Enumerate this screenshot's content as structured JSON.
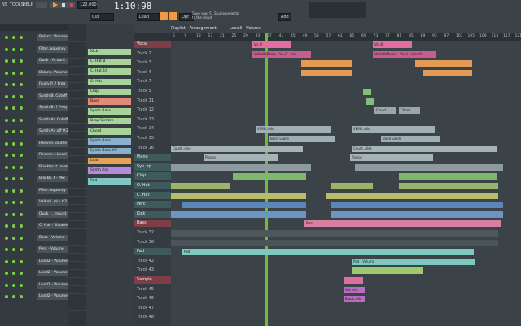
{
  "menu": [
    "NS",
    "TOOLS",
    "HELP"
  ],
  "transport": {
    "tempo": "122.000",
    "time": "1:10:98",
    "pattern": "Lead",
    "mode": "Cut",
    "hint": "Save your FL Studio projects to the cloud",
    "add": "Add"
  },
  "playlist": {
    "title": "Playlist - Arrangement",
    "crumb": "Lead3 - Volume"
  },
  "mixer_tracks": [
    "Balanc..Volume",
    "Filter..equency",
    "Duck - A..ount",
    "Balanc..Volume",
    "Fruity P..? Freq",
    "Synth B..Cutoff",
    "Synth B..? Freq",
    "Synth Ar..Cutoff",
    "Synth Ar..off #2",
    "Heaven..olume",
    "Reverb..t Level",
    "Blackho..t Level",
    "Blackh..t - Mix",
    "Filter..equency",
    "Valhall..mix #2",
    "Duck - ..mount",
    "C. Hat - Volume",
    "Bass - Volume",
    "Perc - Volume",
    "Lead2 - Volume",
    "Lead2 - Volume",
    "Lead1 - Volume",
    "Lead2 - Volume"
  ],
  "channels": [
    {
      "name": "Kick",
      "color": "#a7d29a"
    },
    {
      "name": "C. Hat B",
      "color": "#a7d29a"
    },
    {
      "name": "C. Hat 16",
      "color": "#a7d29a"
    },
    {
      "name": "O. Hat",
      "color": "#a7d29a"
    },
    {
      "name": "Clap",
      "color": "#a7d29a"
    },
    {
      "name": "Bass",
      "color": "#e08a7a"
    },
    {
      "name": "Synth Bass",
      "color": "#a7d29a"
    },
    {
      "name": "Drop Stretch",
      "color": "#a7d29a"
    },
    {
      "name": "Chord",
      "color": "#a7d29a"
    },
    {
      "name": "Synth Bass",
      "color": "#8ab0cc"
    },
    {
      "name": "Synth Bass #2",
      "color": "#8ab0cc"
    },
    {
      "name": "Lead",
      "color": "#e6a15a"
    },
    {
      "name": "Synth Arp",
      "color": "#b58ad8"
    },
    {
      "name": "Pad",
      "color": "#7fc7c2"
    }
  ],
  "tracks": [
    "Vocal",
    "Track 2",
    "Track 3",
    "Track 4",
    "Track 7",
    "Track 9",
    "Track 11",
    "Track 12",
    "Track 13",
    "Track 14",
    "Track 15",
    "Track 16",
    "Piano",
    "Syn..rp",
    "Clap",
    "O. Hat",
    "C. Hat",
    "Perc",
    "Kick",
    "Bass",
    "Track 32",
    "Track 36",
    "Pad",
    "Track 42",
    "Track 43",
    "Sample",
    "Track 45",
    "Track 46",
    "Track 47",
    "Track 48"
  ],
  "ruler": [
    "5",
    "9",
    "13",
    "17",
    "21",
    "25",
    "29",
    "33",
    "37",
    "41",
    "45",
    "49",
    "53",
    "57",
    "61",
    "65",
    "69",
    "73",
    "77",
    "81",
    "85",
    "89",
    "93",
    "97",
    "101",
    "105",
    "109",
    "113",
    "117",
    "121"
  ],
  "clips": {
    "vocal_a": "Vo..A",
    "vocal_b": "Vo..B",
    "valhalla_a": "ValhallaRoom - Vo..A - mix",
    "valhalla_b": "ValhallaRoom - Vo..A - mix #2",
    "chord": "Chord",
    "verb": "VERB..elis",
    "build": "Build Leads",
    "count": "Count..dies",
    "piano": "Pianos",
    "pad": "Pad",
    "pad_vol": "Pad - Volume",
    "bass": "Bass",
    "black": "Black..Mix",
    "valhalla_short": "Val..mix"
  },
  "colors": {
    "accent": "#f59a3c",
    "playhead": "#7ad13a",
    "grid_bg": "#3b4349"
  }
}
